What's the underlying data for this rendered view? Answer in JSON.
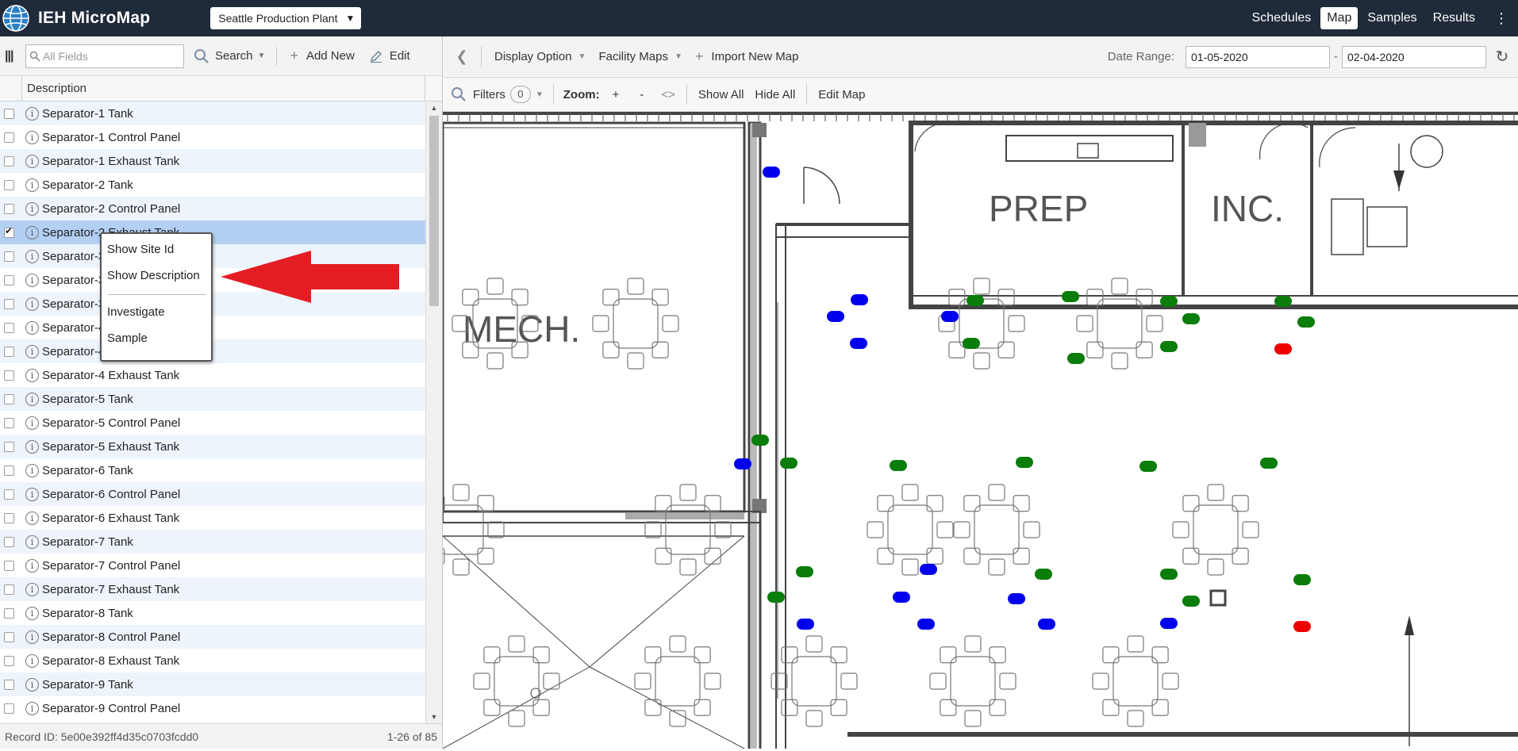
{
  "app": {
    "title": "IEH MicroMap",
    "site": "Seattle Production Plant"
  },
  "nav": {
    "schedules": "Schedules",
    "map": "Map",
    "samples": "Samples",
    "results": "Results",
    "more": "⋮"
  },
  "toolbar": {
    "search_placeholder": "All Fields",
    "search": "Search",
    "add_new": "Add New",
    "edit": "Edit"
  },
  "grid": {
    "column": "Description",
    "rows": [
      {
        "label": "Separator-1 Tank",
        "checked": false
      },
      {
        "label": "Separator-1 Control Panel",
        "checked": false
      },
      {
        "label": "Separator-1 Exhaust Tank",
        "checked": false
      },
      {
        "label": "Separator-2 Tank",
        "checked": false
      },
      {
        "label": "Separator-2 Control Panel",
        "checked": false
      },
      {
        "label": "Separator-2 Exhaust Tank",
        "checked": true
      },
      {
        "label": "Separator-3 Tank",
        "checked": false
      },
      {
        "label": "Separator-3 Control Panel",
        "checked": false
      },
      {
        "label": "Separator-3 Exhaust Tank",
        "checked": false
      },
      {
        "label": "Separator-4 Tank",
        "checked": false
      },
      {
        "label": "Separator-4 Control Panel",
        "checked": false
      },
      {
        "label": "Separator-4 Exhaust Tank",
        "checked": false
      },
      {
        "label": "Separator-5 Tank",
        "checked": false
      },
      {
        "label": "Separator-5 Control Panel",
        "checked": false
      },
      {
        "label": "Separator-5 Exhaust Tank",
        "checked": false
      },
      {
        "label": "Separator-6 Tank",
        "checked": false
      },
      {
        "label": "Separator-6 Control Panel",
        "checked": false
      },
      {
        "label": "Separator-6 Exhaust Tank",
        "checked": false
      },
      {
        "label": "Separator-7 Tank",
        "checked": false
      },
      {
        "label": "Separator-7 Control Panel",
        "checked": false
      },
      {
        "label": "Separator-7 Exhaust Tank",
        "checked": false
      },
      {
        "label": "Separator-8 Tank",
        "checked": false
      },
      {
        "label": "Separator-8 Control Panel",
        "checked": false
      },
      {
        "label": "Separator-8 Exhaust Tank",
        "checked": false
      },
      {
        "label": "Separator-9 Tank",
        "checked": false
      },
      {
        "label": "Separator-9 Control Panel",
        "checked": false
      }
    ]
  },
  "status": {
    "record_id": "Record ID: 5e00e392ff4d35c0703fcdd0",
    "range": "1-26 of 85"
  },
  "context_menu": {
    "show_site_id": "Show Site Id",
    "show_description": "Show Description",
    "investigate": "Investigate",
    "sample": "Sample"
  },
  "map_toolbar": {
    "display_option": "Display Option",
    "facility_maps": "Facility Maps",
    "import_new_map": "Import New Map",
    "date_range_label": "Date Range:",
    "date_from": "01-05-2020",
    "date_to": "02-04-2020",
    "date_sep": "-"
  },
  "filter_bar": {
    "filters": "Filters",
    "filter_count": "0",
    "zoom": "Zoom:",
    "zoom_in": "+",
    "zoom_out": "-",
    "zoom_fit": "<>",
    "show_all": "Show All",
    "hide_all": "Hide All",
    "edit_map": "Edit Map"
  },
  "map": {
    "rooms": {
      "prep": "PREP",
      "inc": "INC.",
      "mech": "MECH."
    }
  },
  "colors": {
    "marker_blue": "#0000ee",
    "marker_green": "#0a7d0a",
    "marker_red": "#ee0000",
    "annotation_arrow": "#e41d23",
    "header_bg": "#1f2a3a"
  }
}
